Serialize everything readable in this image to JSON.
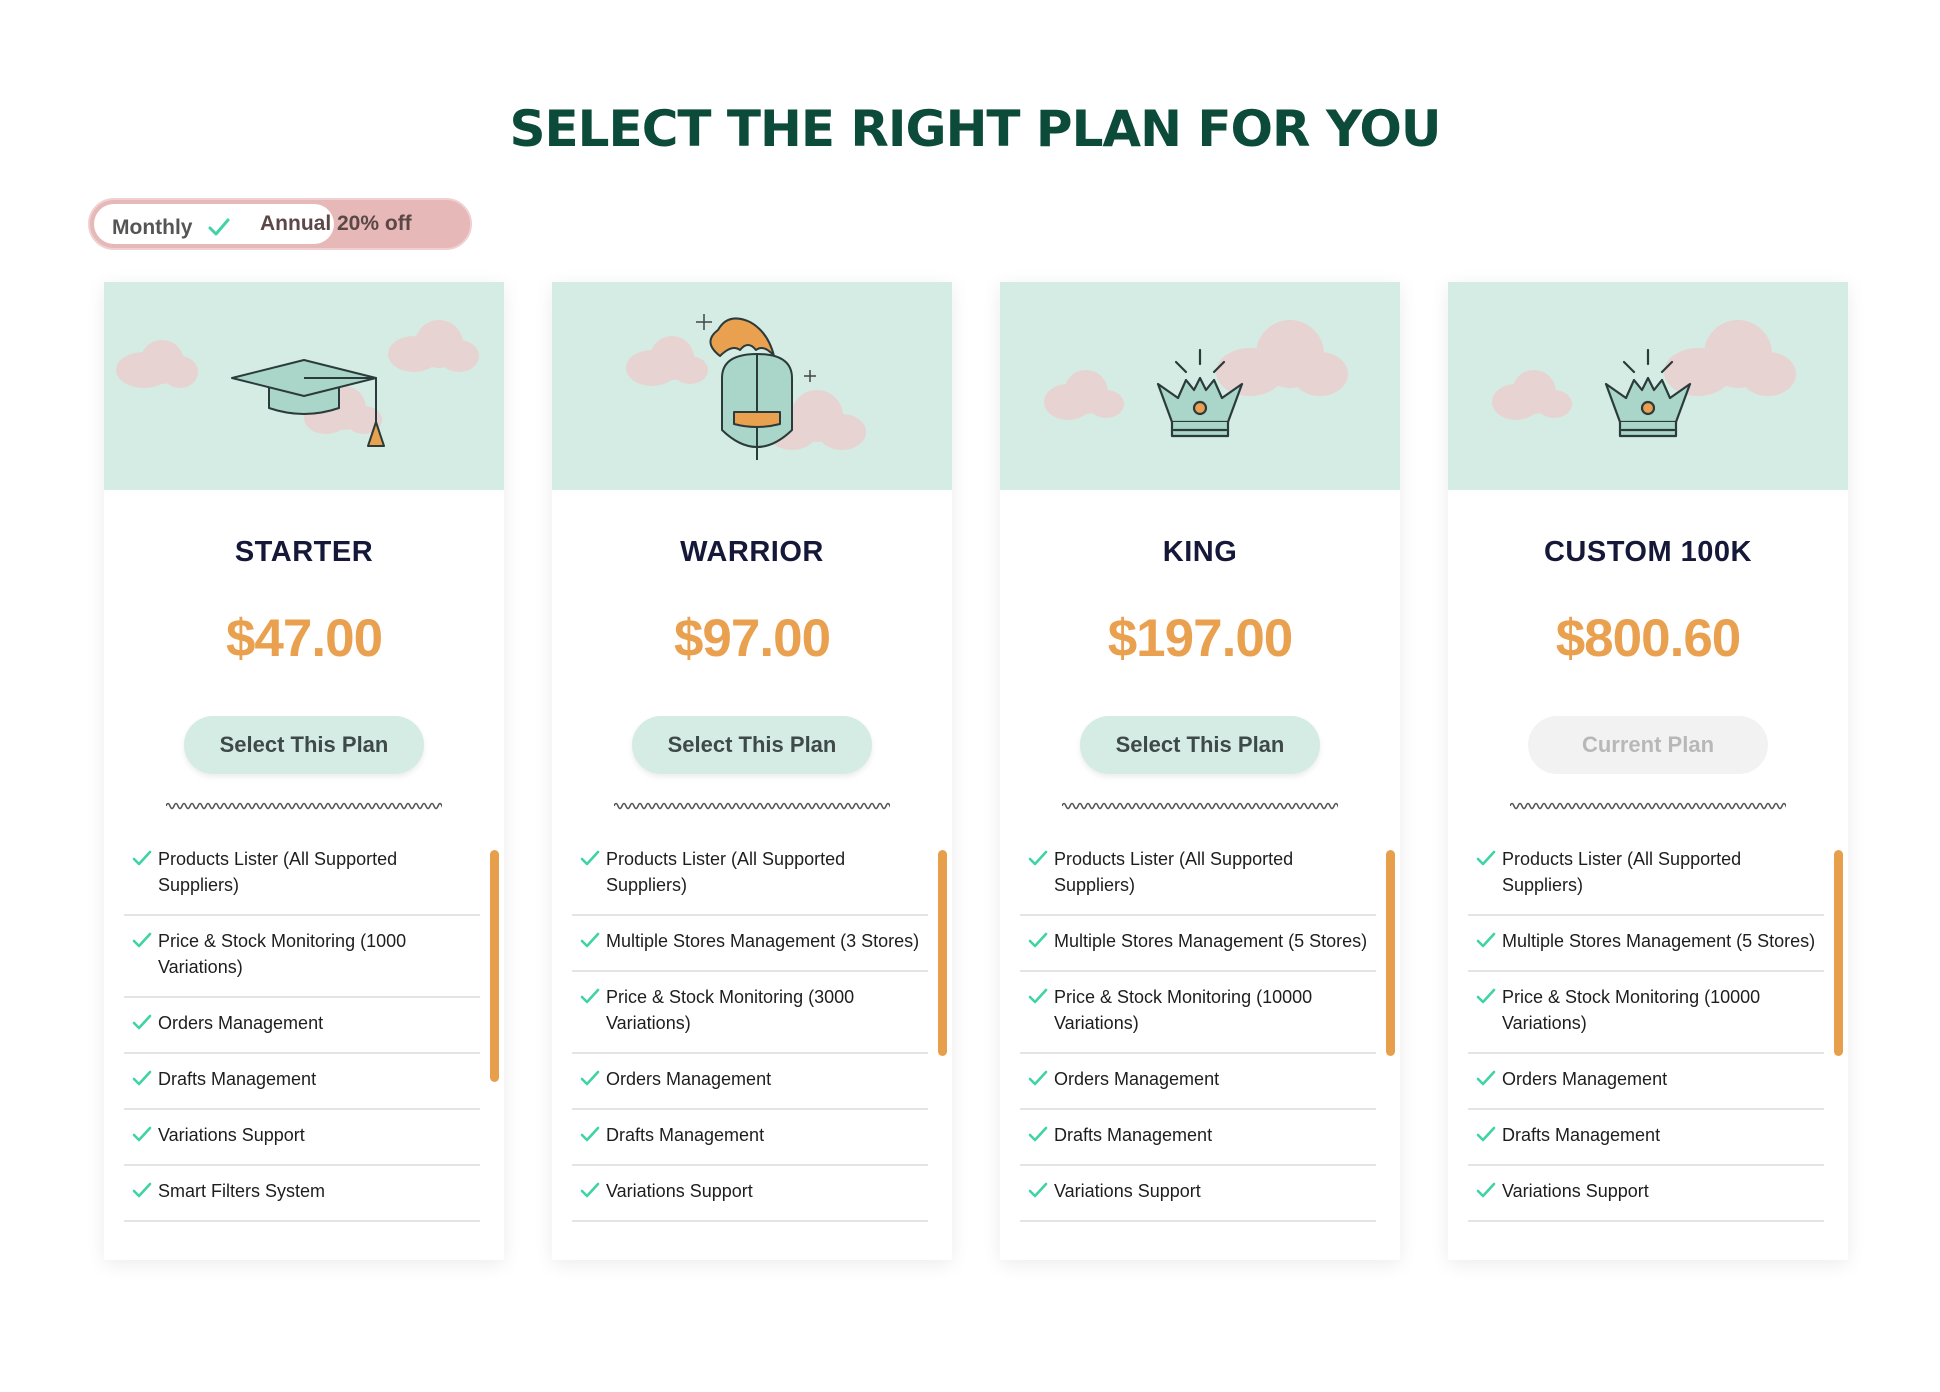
{
  "page": {
    "title": "SELECT THE RIGHT PLAN FOR YOU"
  },
  "billing_toggle": {
    "monthly_label": "Monthly",
    "annual_label": "Annual 20% off",
    "selected": "Monthly"
  },
  "colors": {
    "title": "#0c4a3a",
    "price": "#e9a04f",
    "banner": "#d5ece5",
    "check": "#3fd3a5",
    "scrollbar": "#e89f4c",
    "cloud": "#e7d3d1"
  },
  "plans": [
    {
      "name": "STARTER",
      "price": "$47.00",
      "button_label": "Select This Plan",
      "is_current": false,
      "icon": "graduation-cap-icon",
      "features": [
        "Products Lister (All Supported Suppliers)",
        "Price & Stock Monitoring (1000 Variations)",
        "Orders Management",
        "Drafts Management",
        "Variations Support",
        "Smart Filters System"
      ]
    },
    {
      "name": "WARRIOR",
      "price": "$97.00",
      "button_label": "Select This Plan",
      "is_current": false,
      "icon": "knight-helmet-icon",
      "features": [
        "Products Lister (All Supported Suppliers)",
        "Multiple Stores Management (3 Stores)",
        "Price & Stock Monitoring (3000 Variations)",
        "Orders Management",
        "Drafts Management",
        "Variations Support"
      ]
    },
    {
      "name": "KING",
      "price": "$197.00",
      "button_label": "Select This Plan",
      "is_current": false,
      "icon": "crown-icon",
      "features": [
        "Products Lister (All Supported Suppliers)",
        "Multiple Stores Management (5 Stores)",
        "Price & Stock Monitoring (10000 Variations)",
        "Orders Management",
        "Drafts Management",
        "Variations Support"
      ]
    },
    {
      "name": "CUSTOM 100K",
      "price": "$800.60",
      "button_label": "Current Plan",
      "is_current": true,
      "icon": "crown-icon",
      "features": [
        "Products Lister (All Supported Suppliers)",
        "Multiple Stores Management (5 Stores)",
        "Price & Stock Monitoring (10000 Variations)",
        "Orders Management",
        "Drafts Management",
        "Variations Support"
      ]
    }
  ]
}
